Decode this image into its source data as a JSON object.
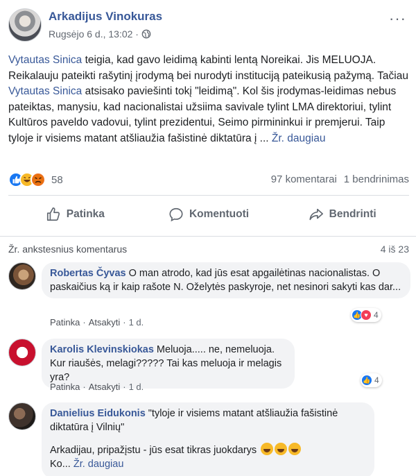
{
  "post": {
    "author": "Arkadijus Vinokuras",
    "timestamp": "Rugsėjo 6 d., 13:02 ·",
    "audience_icon": "globe-icon",
    "more_icon": "···",
    "text_parts": {
      "p1": "Vytautas Sinica",
      "p2": " teigia, kad gavo leidimą kabinti lentą Noreikai. Jis MELUOJA. Reikalauju pateikti rašytinį įrodymą bei nurodyti instituciją pateikusią pažymą. Tačiau ",
      "p3": "Vytautas Sinica",
      "p4": " atsisako paviešinti tokį \"leidimą\". Kol šis įrodymas-leidimas nebus pateiktas, manysiu, kad nacionalistai užsiima savivale tylint LMA direktoriui, tylint Kultūros paveldo vadovui, tylint prezidentui, Seimo pirmininkui ir premjerui. Taip tyloje ir visiems matant atšliaužia fašistinė diktatūra į ... ",
      "p5": "Žr. daugiau"
    },
    "reaction_count": "58",
    "comments_count": "97 komentarai",
    "shares_count": "1 bendrinimas"
  },
  "actions": {
    "like": "Patinka",
    "comment": "Komentuoti",
    "share": "Bendrinti"
  },
  "comments_header": {
    "previous": "Žr. ankstesnius komentarus",
    "page": "4 iš 23"
  },
  "comments": [
    {
      "name": "Robertas Čyvas",
      "text": "O man atrodo, kad jūs esat apgailėtinas nacionalistas. O paskaičius ką ir kaip rašote N. Oželytės paskyroje, net nesinori sakyti kas dar...",
      "like": "Patinka",
      "reply": "Atsakyti",
      "time": "1 d.",
      "reactions": "4"
    },
    {
      "name": "Karolis Klevinskiokas",
      "text": "Meluoja..... ne, nemeluoja. Kur riaušės, melagi????? Tai kas meluoja ir melagis yra?",
      "like": "Patinka",
      "reply": "Atsakyti",
      "time": "1 d.",
      "reactions": "4"
    },
    {
      "name": "Danielius Eidukonis",
      "text1": "\"tyloje ir visiems matant atšliaužia fašistinė diktatūra į Vilnių\"",
      "text2": "Arkadijau, pripažįstu - jūs esat tikras juokdarys",
      "text3": "Ko... ",
      "see_more": "Žr. daugiau"
    }
  ],
  "separator": " · "
}
